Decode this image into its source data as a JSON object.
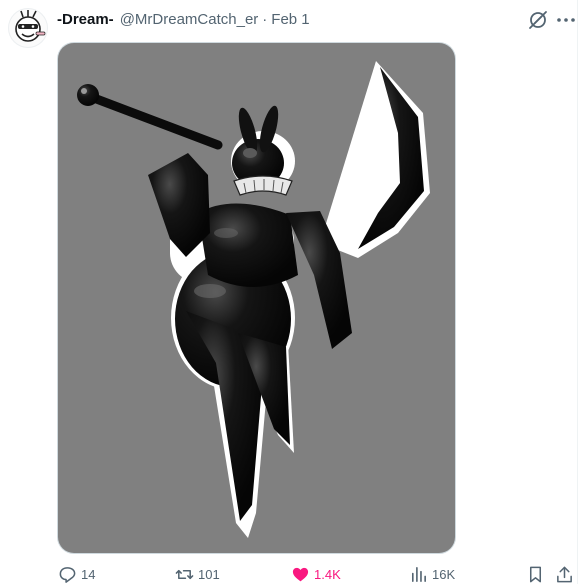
{
  "tweet": {
    "display_name": "-Dream-",
    "handle": "@MrDreamCatch_er",
    "separator": "·",
    "date": "Feb 1"
  },
  "actions": {
    "replies": "14",
    "reposts": "101",
    "likes": "1.4K",
    "views": "16K"
  },
  "colors": {
    "like_active": "#f91880",
    "muted_text": "#536471",
    "media_background": "#808080"
  },
  "icons": [
    "grok-icon",
    "more-icon",
    "reply-icon",
    "repost-icon",
    "like-icon",
    "views-icon",
    "bookmark-icon",
    "share-icon"
  ]
}
